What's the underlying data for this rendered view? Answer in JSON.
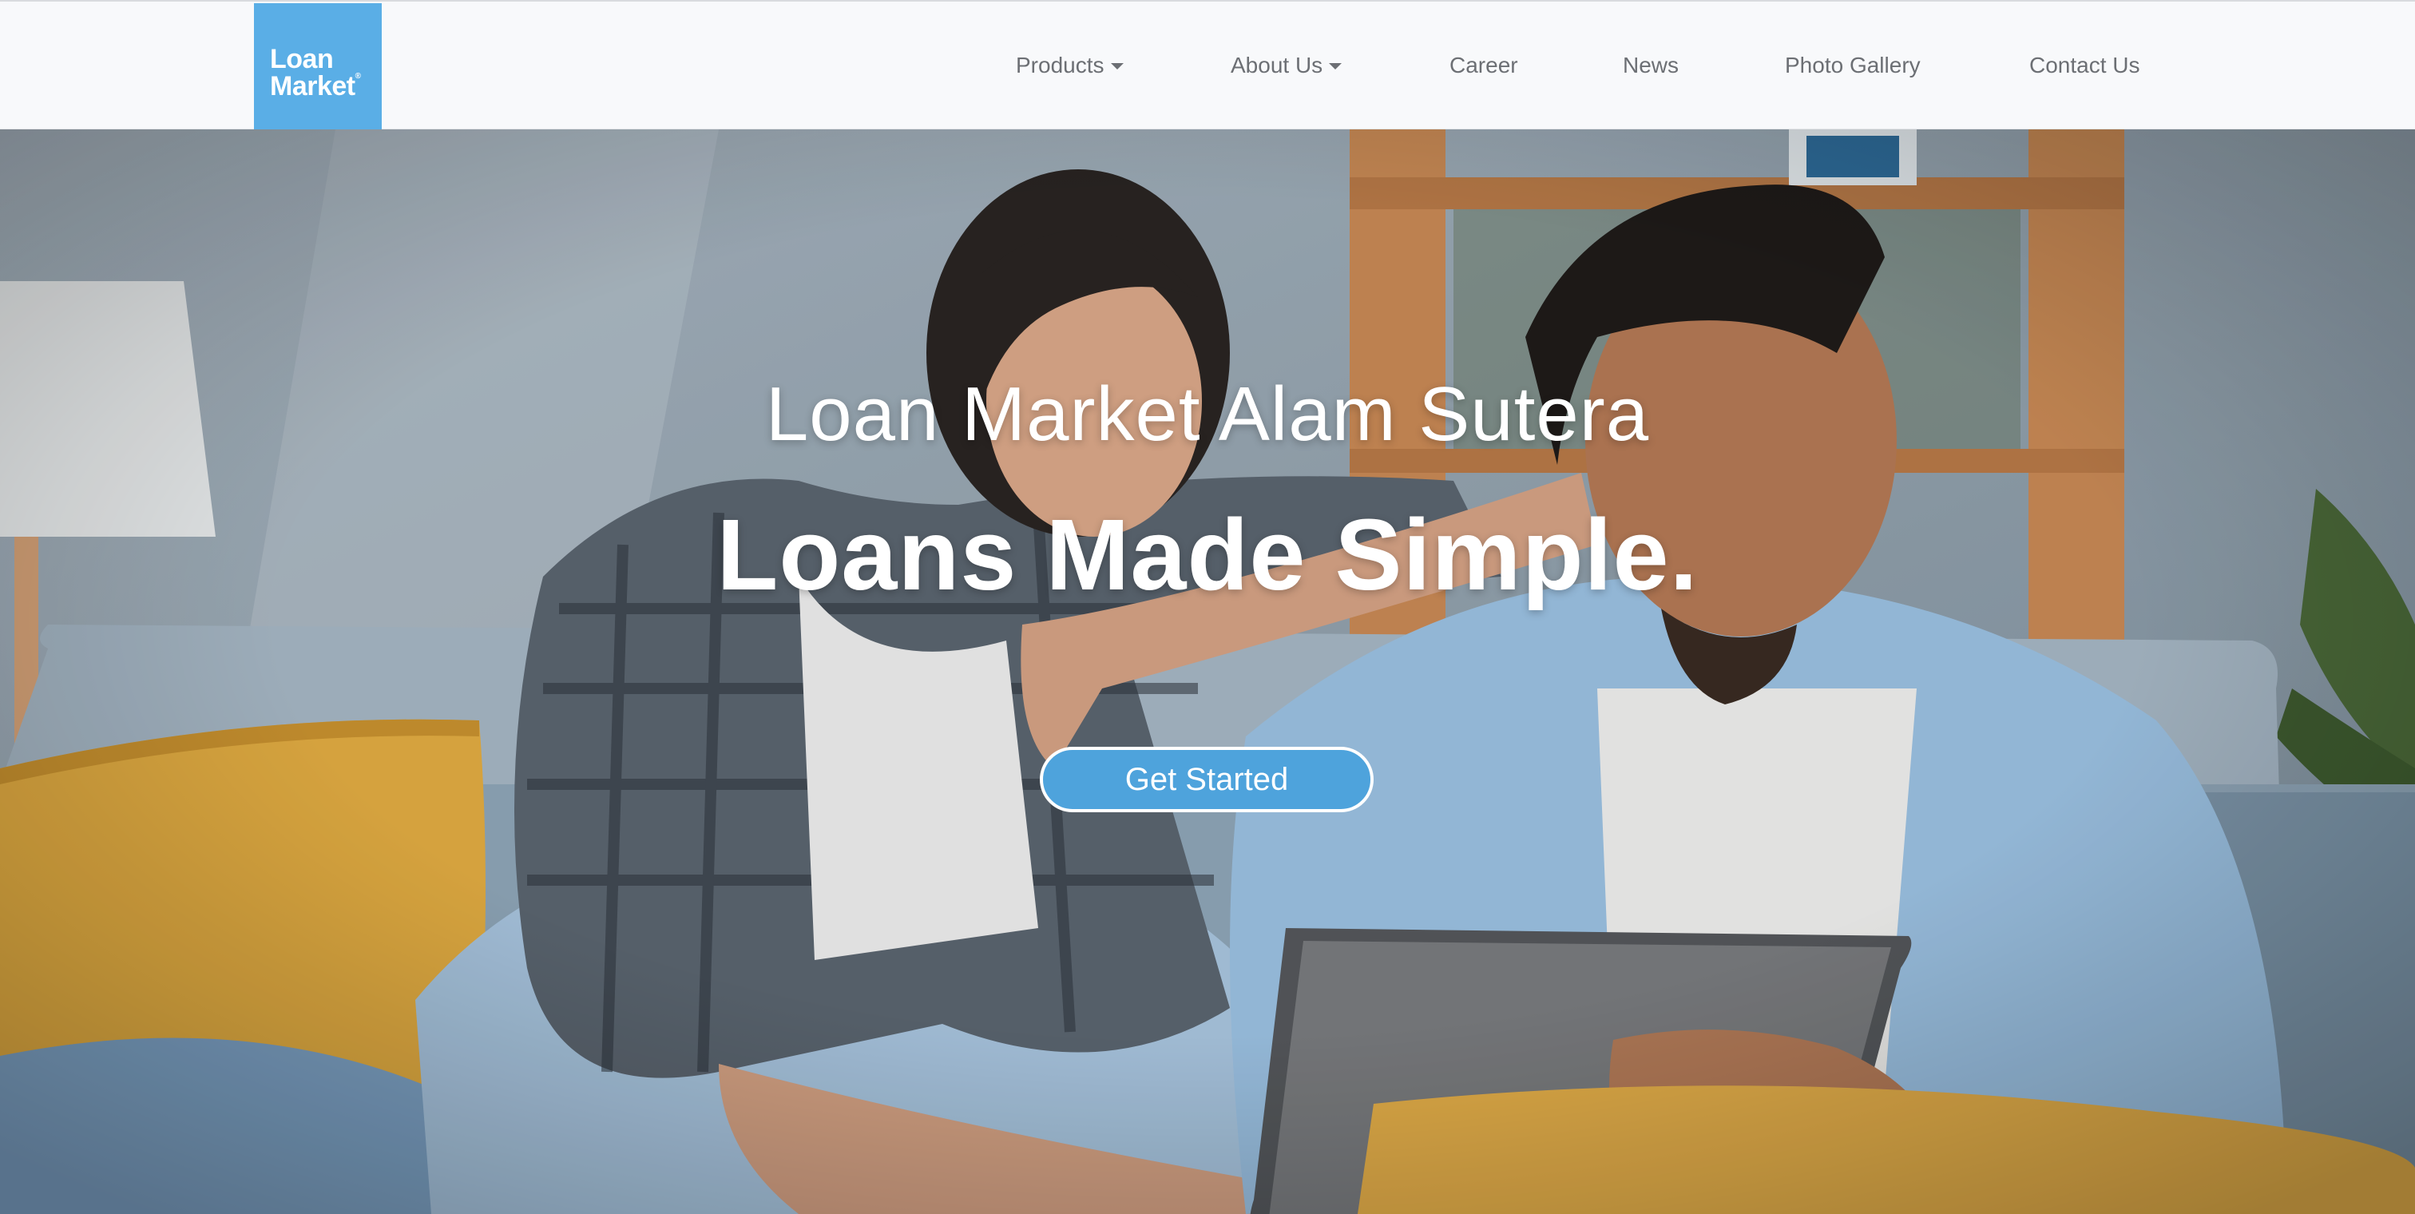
{
  "brand": {
    "logo_line1": "Loan",
    "logo_line2": "Market",
    "logo_color": "#5aaee6"
  },
  "nav": {
    "items": [
      {
        "label": "Products",
        "dropdown": true
      },
      {
        "label": "About Us",
        "dropdown": true
      },
      {
        "label": "Career",
        "dropdown": false
      },
      {
        "label": "News",
        "dropdown": false
      },
      {
        "label": "Photo Gallery",
        "dropdown": false
      },
      {
        "label": "Contact Us",
        "dropdown": false
      }
    ]
  },
  "hero": {
    "subtitle": "Loan Market Alam Sutera",
    "title": "Loans Made Simple.",
    "cta_label": "Get Started",
    "cta_color": "#4ea3dc",
    "background_image": "couple-on-sofa-with-tablet"
  }
}
